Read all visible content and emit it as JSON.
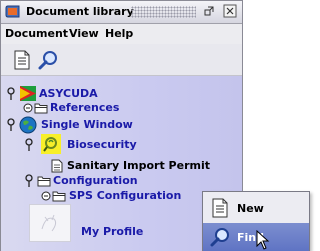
{
  "window": {
    "title": "Document library"
  },
  "menu": [
    "Document",
    "View",
    "Help"
  ],
  "toolbar": {
    "new_icon": "new-document-icon",
    "find_icon": "magnifier-icon"
  },
  "tree": {
    "asycuda": "ASYCUDA",
    "references": "References",
    "single_window": "Single Window",
    "biosecurity": "Biosecurity",
    "sanitary_import_permit": "Sanitary Import Permit",
    "configuration": "Configuration",
    "sps_configuration": "SPS Configuration",
    "my_profile": "My Profile"
  },
  "context_menu": {
    "items": [
      {
        "label": "New",
        "icon": "new-document-icon"
      },
      {
        "label": "Find",
        "icon": "magnifier-icon",
        "highlighted": true
      }
    ]
  },
  "colors": {
    "tree_link": "#1a1aa8",
    "menu_highlight": "#6478c6"
  }
}
